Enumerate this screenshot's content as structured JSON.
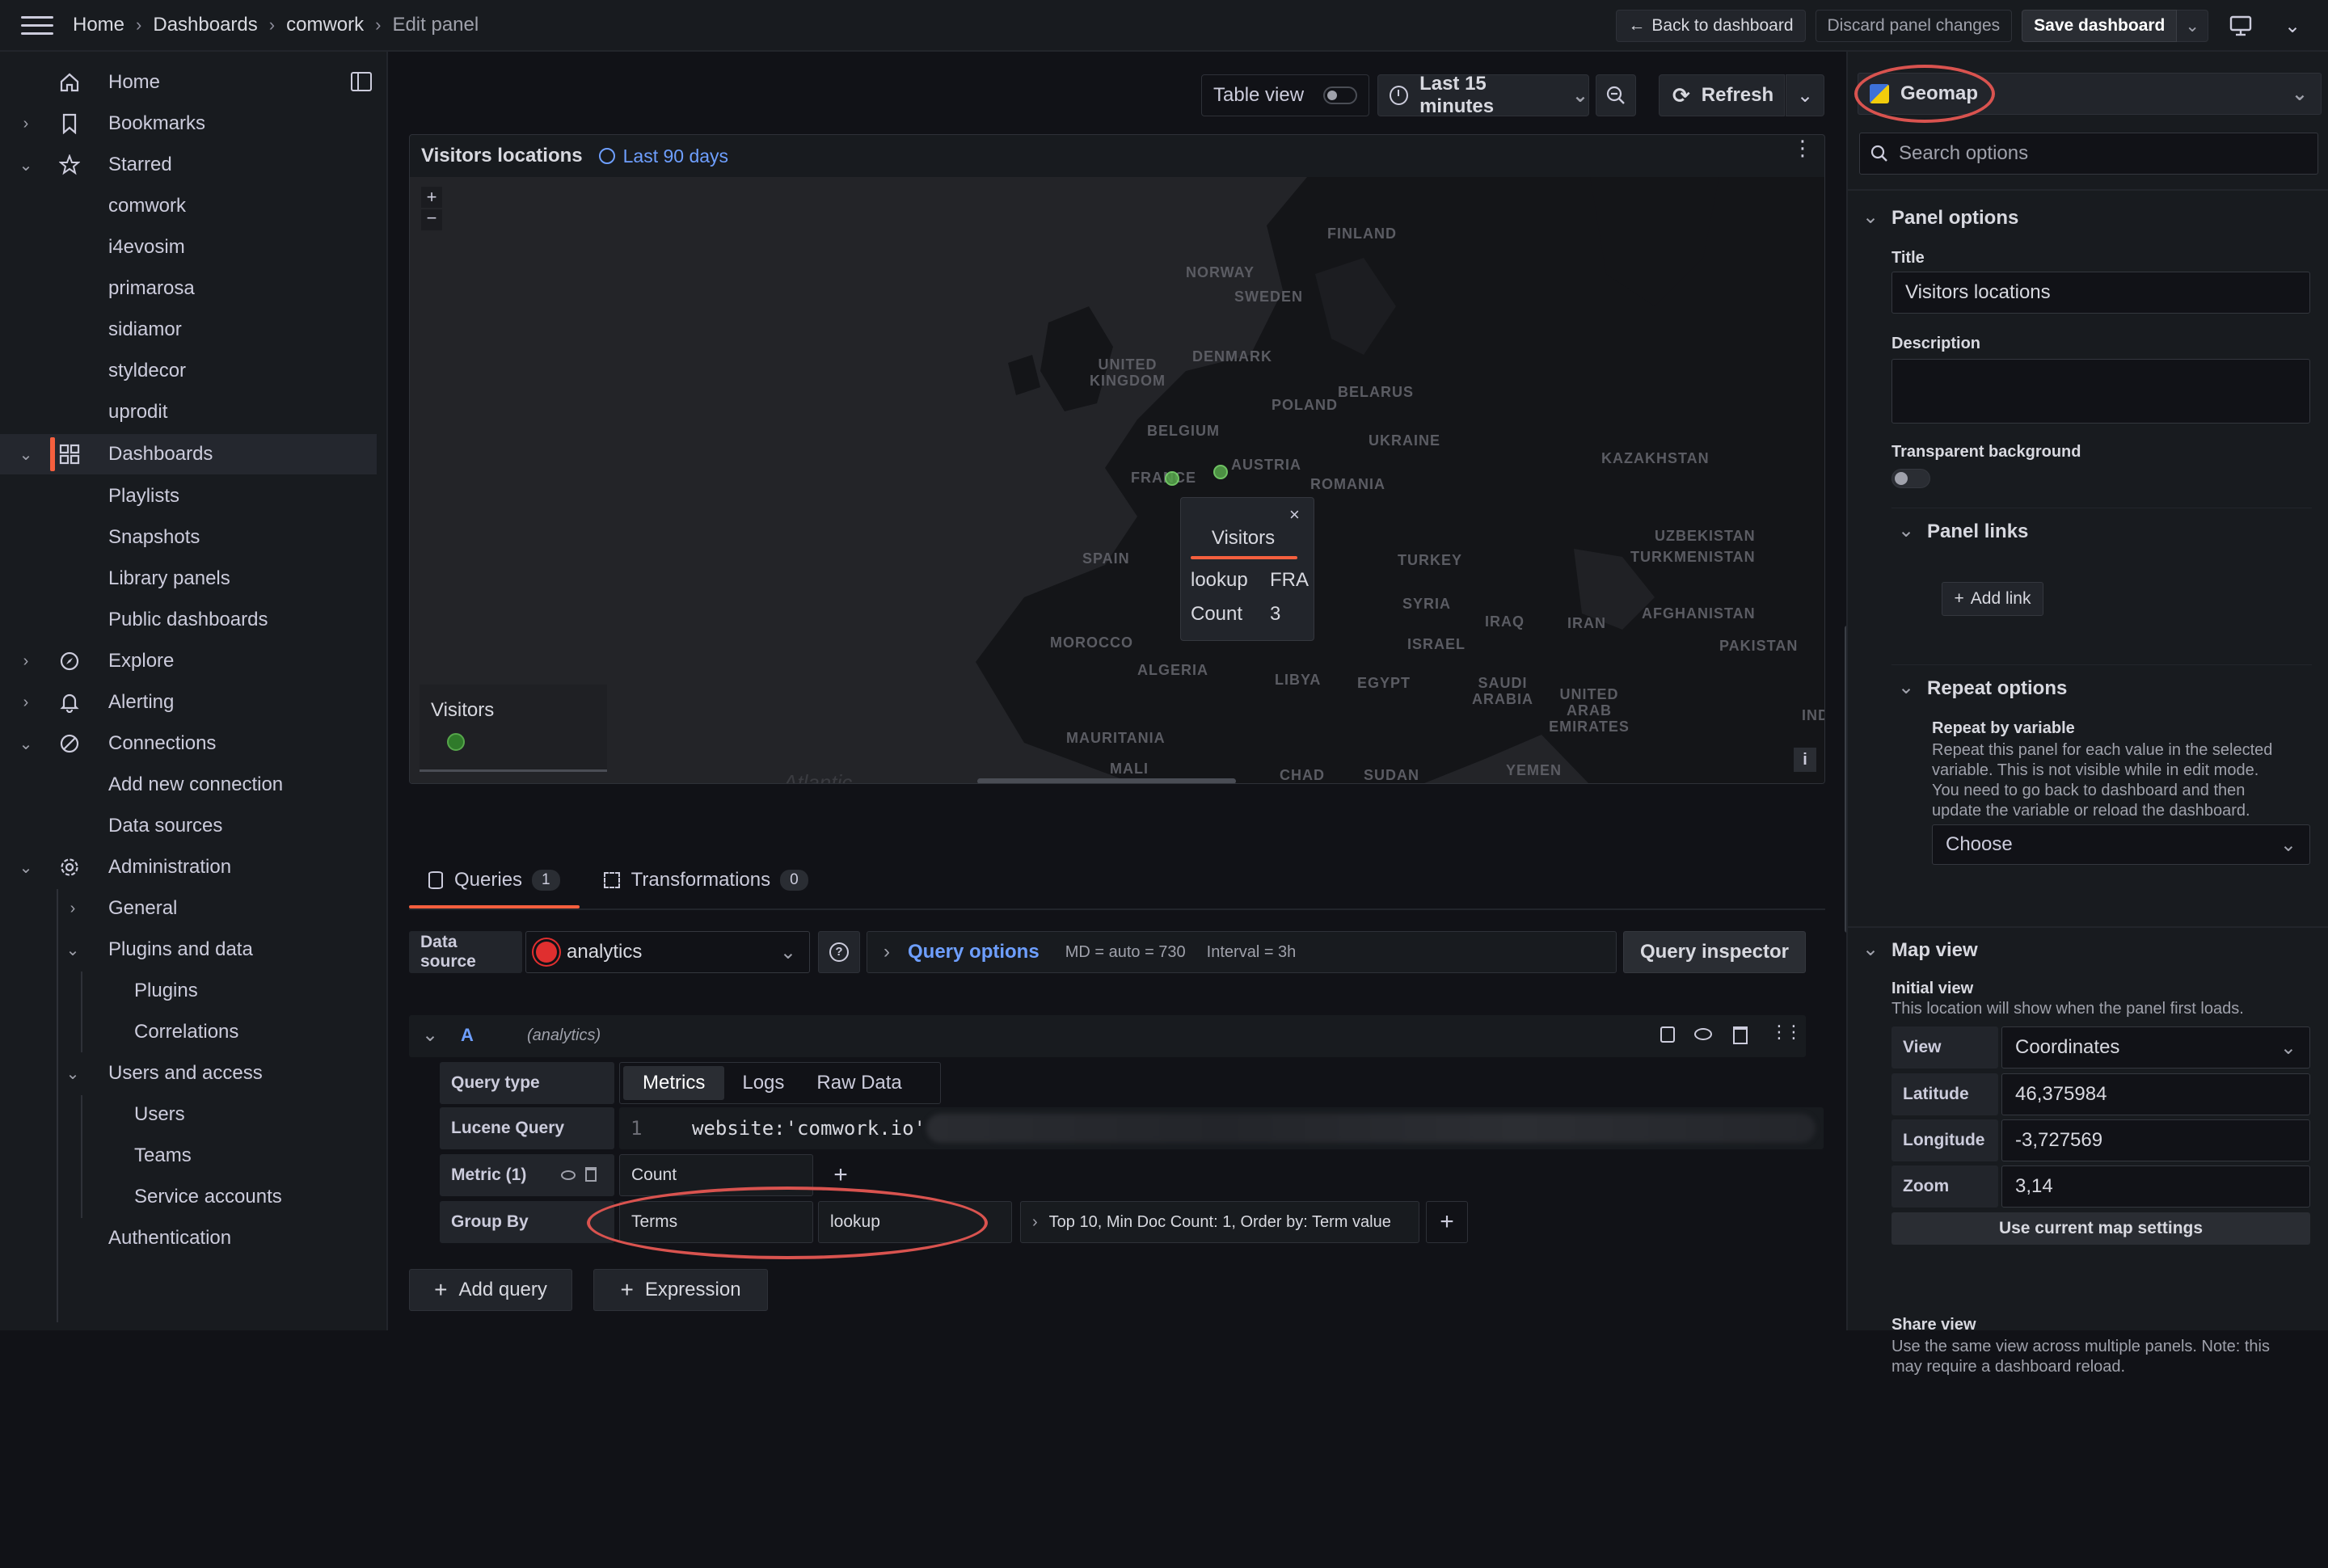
{
  "breadcrumb": [
    "Home",
    "Dashboards",
    "comwork",
    "Edit panel"
  ],
  "top": {
    "back": "Back to dashboard",
    "discard": "Discard panel changes",
    "save": "Save dashboard"
  },
  "sidebar": {
    "home": "Home",
    "bookmarks": "Bookmarks",
    "starred": "Starred",
    "starred_items": [
      "comwork",
      "i4evosim",
      "primarosa",
      "sidiamor",
      "styldecor",
      "uprodit"
    ],
    "dashboards": "Dashboards",
    "dash_items": [
      "Playlists",
      "Snapshots",
      "Library panels",
      "Public dashboards"
    ],
    "explore": "Explore",
    "alerting": "Alerting",
    "connections": "Connections",
    "conn_items": [
      "Add new connection",
      "Data sources"
    ],
    "administration": "Administration",
    "general": "General",
    "plugins_data": "Plugins and data",
    "plugins_items": [
      "Plugins",
      "Correlations"
    ],
    "users_access": "Users and access",
    "users_items": [
      "Users",
      "Teams",
      "Service accounts"
    ],
    "authentication": "Authentication"
  },
  "toolbar": {
    "table_view": "Table view",
    "time_range": "Last 15 minutes",
    "refresh": "Refresh"
  },
  "panel": {
    "title": "Visitors locations",
    "time": "Last 90 days",
    "legend_title": "Visitors",
    "map_attrib": "Atlantic"
  },
  "map_labels": [
    "FINLAND",
    "SWEDEN",
    "NORWAY",
    "UNITED KINGDOM",
    "DENMARK",
    "BELARUS",
    "POLAND",
    "BELGIUM",
    "UKRAINE",
    "KAZAKHSTAN",
    "FRANCE",
    "AUSTRIA",
    "ROMANIA",
    "UZBEKISTAN",
    "TURKMENISTAN",
    "SPAIN",
    "TURKEY",
    "SYRIA",
    "IRAQ",
    "IRAN",
    "AFGHANISTAN",
    "PAKISTAN",
    "MOROCCO",
    "ALGERIA",
    "LIBYA",
    "EGYPT",
    "ISRAEL",
    "SAUDI ARABIA",
    "UNITED ARAB EMIRATES",
    "INDIA",
    "MAURITANIA",
    "MALI",
    "CHAD",
    "SUDAN",
    "YEMEN"
  ],
  "tooltip": {
    "title": "Visitors",
    "rows": [
      {
        "k": "lookup",
        "v": "FRA"
      },
      {
        "k": "Count",
        "v": "3"
      }
    ]
  },
  "tabs": {
    "queries": "Queries",
    "queries_count": "1",
    "transformations": "Transformations",
    "transformations_count": "0"
  },
  "query": {
    "ds_label": "Data source",
    "ds_value": "analytics",
    "options": "Query options",
    "md": "MD = auto = 730",
    "interval": "Interval = 3h",
    "inspector": "Query inspector",
    "ref": "A",
    "ref_ds": "(analytics)",
    "type_label": "Query type",
    "types": [
      "Metrics",
      "Logs",
      "Raw Data"
    ],
    "lucene_label": "Lucene Query",
    "line_no": "1",
    "lucene": "website:'comwork.io'",
    "metric_label": "Metric (1)",
    "metric_value": "Count",
    "groupby_label": "Group By",
    "groupby_type": "Terms",
    "groupby_field": "lookup",
    "groupby_opts": "Top 10, Min Doc Count: 1, Order by: Term value",
    "add_query": "Add query",
    "expression": "Expression"
  },
  "right": {
    "viz": "Geomap",
    "search": "Search options",
    "panel_options": "Panel options",
    "title_label": "Title",
    "title_value": "Visitors locations",
    "desc_label": "Description",
    "transparent": "Transparent background",
    "panel_links": "Panel links",
    "add_link": "Add link",
    "repeat": "Repeat options",
    "repeat_by": "Repeat by variable",
    "repeat_desc": [
      "Repeat this panel for each value in the selected",
      "variable. This is not visible while in edit mode.",
      "You need to go back to dashboard and then",
      "update the variable or reload the dashboard."
    ],
    "choose": "Choose",
    "map_view": "Map view",
    "initial_view": "Initial view",
    "initial_desc": "This location will show when the panel first loads.",
    "view_label": "View",
    "view_value": "Coordinates",
    "lat_label": "Latitude",
    "lat_value": "46,375984",
    "lon_label": "Longitude",
    "lon_value": "-3,727569",
    "zoom_label": "Zoom",
    "zoom_value": "3,14",
    "use_current": "Use current map settings",
    "share_view": "Share view",
    "share_desc": [
      "Use the same view across multiple panels. Note: this",
      "may require a dashboard reload."
    ]
  }
}
